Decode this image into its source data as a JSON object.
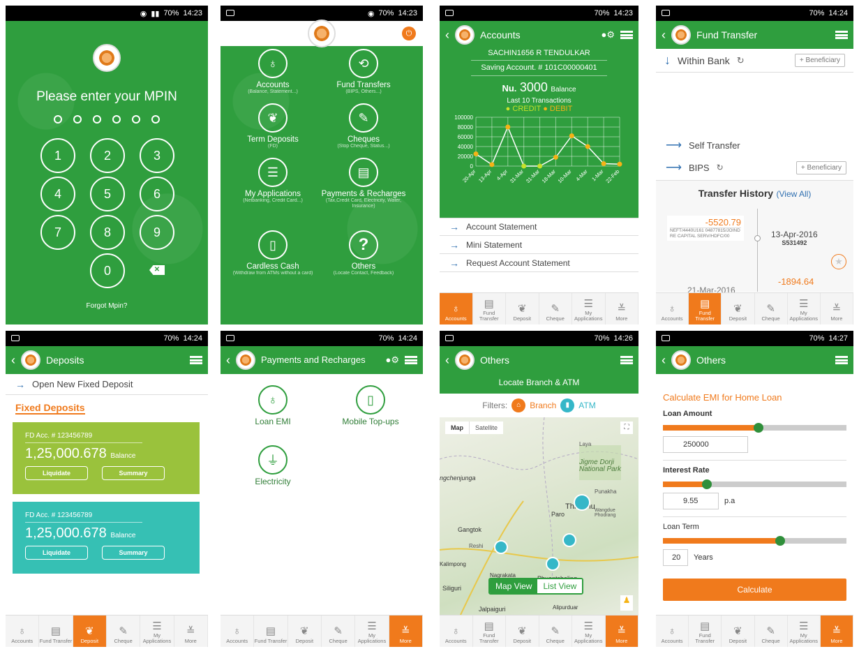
{
  "status": {
    "s1": {
      "battery": "70%",
      "time": "14:23"
    },
    "s2": {
      "battery": "70%",
      "time": "14:23"
    },
    "s3": {
      "battery": "70%",
      "time": "14:23"
    },
    "s4": {
      "battery": "70%",
      "time": "14:24"
    },
    "s5": {
      "battery": "70%",
      "time": "14:24"
    },
    "s6": {
      "battery": "70%",
      "time": "14:24"
    },
    "s7": {
      "battery": "70%",
      "time": "14:26"
    },
    "s8": {
      "battery": "70%",
      "time": "14:27"
    }
  },
  "logo_text": "BOB",
  "mpin": {
    "title": "Please enter your MPIN",
    "keys": [
      "1",
      "2",
      "3",
      "4",
      "5",
      "6",
      "7",
      "8",
      "9",
      "0"
    ],
    "forgot": "Forgot Mpin?"
  },
  "home": {
    "tiles": [
      {
        "label": "Accounts",
        "sub": "(Balance, Statement...)"
      },
      {
        "label": "Fund Transfers",
        "sub": "(BIPS, Others...)"
      },
      {
        "label": "Term Deposits",
        "sub": "(FD)"
      },
      {
        "label": "Cheques",
        "sub": "(Stop Cheque, Status...)"
      },
      {
        "label": "My Applications",
        "sub": "(Netbanking, Credit Card...)"
      },
      {
        "label": "Payments & Recharges",
        "sub": "(Tax,Credit Card, Electricity, Water, Insurance)"
      },
      {
        "label": "Cardless Cash",
        "sub": "(Withdraw from ATMs without a card)"
      },
      {
        "label": "Others",
        "sub": "(Locate Contact, Feedback)"
      }
    ]
  },
  "accounts": {
    "title": "Accounts",
    "name": "SACHIN1656 R TENDULKAR",
    "account": "Saving Account. # 101C00000401",
    "currency": "Nu.",
    "balance": "3000",
    "balance_label": "Balance",
    "last10": "Last 10 Transactions",
    "credit": "CREDIT",
    "debit": "DEBIT",
    "links": [
      "Account Statement",
      "Mini Statement",
      "Request Account Statement"
    ]
  },
  "chart_data": {
    "type": "line",
    "categories": [
      "20-Apr",
      "13-Apr",
      "4-Apr",
      "31-Mar",
      "31-Mar",
      "18-Mar",
      "10-Mar",
      "4-Mar",
      "1-Mar",
      "22-Feb"
    ],
    "values": [
      25000,
      3000,
      80000,
      0,
      0,
      18000,
      62000,
      40000,
      5000,
      4000
    ],
    "point_types": [
      "debit",
      "debit",
      "debit",
      "credit",
      "credit",
      "debit",
      "debit",
      "debit",
      "debit",
      "debit"
    ],
    "yticks": [
      "100000",
      "80000",
      "60000",
      "40000",
      "20000",
      "0"
    ],
    "ylim": [
      0,
      100000
    ],
    "grid": true,
    "colors": {
      "credit": "#c6e22a",
      "debit": "#f5b316"
    }
  },
  "fund": {
    "title": "Fund Transfer",
    "within": "Within Bank",
    "beneficiary": "+ Beneficiary",
    "self": "Self Transfer",
    "bips": "BIPS",
    "history_title": "Transfer History",
    "view_all": "(View All)",
    "h1_amount": "-5520.79",
    "h1_desc": "NEFT/4440U161 04877815/JOIND RE CAPITAL SERV/HDFC/00",
    "h1_date": "13-Apr-2016",
    "h1_ref": "S531492",
    "h2_amount": "-1894.64",
    "h2_date": "21-Mar-2016"
  },
  "deposits": {
    "title": "Deposits",
    "open_new": "Open New Fixed Deposit",
    "section": "Fixed Deposits",
    "cards": [
      {
        "acc": "FD Acc. # 123456789",
        "amount": "1,25,000.678",
        "bal": "Balance",
        "b1": "Liquidate",
        "b2": "Summary"
      },
      {
        "acc": "FD Acc. # 123456789",
        "amount": "1,25,000.678",
        "bal": "Balance",
        "b1": "Liquidate",
        "b2": "Summary"
      }
    ]
  },
  "payments": {
    "title": "Payments and Recharges",
    "tiles": [
      "Loan EMI",
      "Mobile Top-ups",
      "Electricity"
    ]
  },
  "others_map": {
    "title": "Others",
    "header": "Locate Branch & ATM",
    "filters": "Filters:",
    "branch": "Branch",
    "atm": "ATM",
    "map_btn": "Map",
    "sat_btn": "Satellite",
    "places": [
      "Laya",
      "Jigme Dorji National Park",
      "Punakha",
      "Thimphu",
      "Paro",
      "Wangdue Phodrang",
      "Gangtok",
      "Reshi",
      "Kalimpong",
      "Nagrakata",
      "Phuentsholing",
      "Siliguri",
      "Alipurduar",
      "Jalpaiguri",
      "ngchenjunga"
    ],
    "map_view": "Map View",
    "list_view": "List View"
  },
  "emi": {
    "title": "Others",
    "heading": "Calculate EMI for Home Loan",
    "loan_label": "Loan Amount",
    "loan_value": "250000",
    "loan_level": 0.52,
    "rate_label": "Interest Rate",
    "rate_value": "9.55",
    "rate_unit": "p.a",
    "rate_level": 0.24,
    "term_label": "Loan Term",
    "term_value": "20",
    "term_unit": "Years",
    "term_level": 0.64,
    "calculate": "Calculate"
  },
  "tabs": [
    "Accounts",
    "Fund Transfer",
    "Deposit",
    "Cheque",
    "My Applications",
    "More"
  ],
  "tab_icons": [
    "bag-icon",
    "fund-icon",
    "piggy-icon",
    "cheque-icon",
    "doc-icon",
    "sliders-icon"
  ]
}
